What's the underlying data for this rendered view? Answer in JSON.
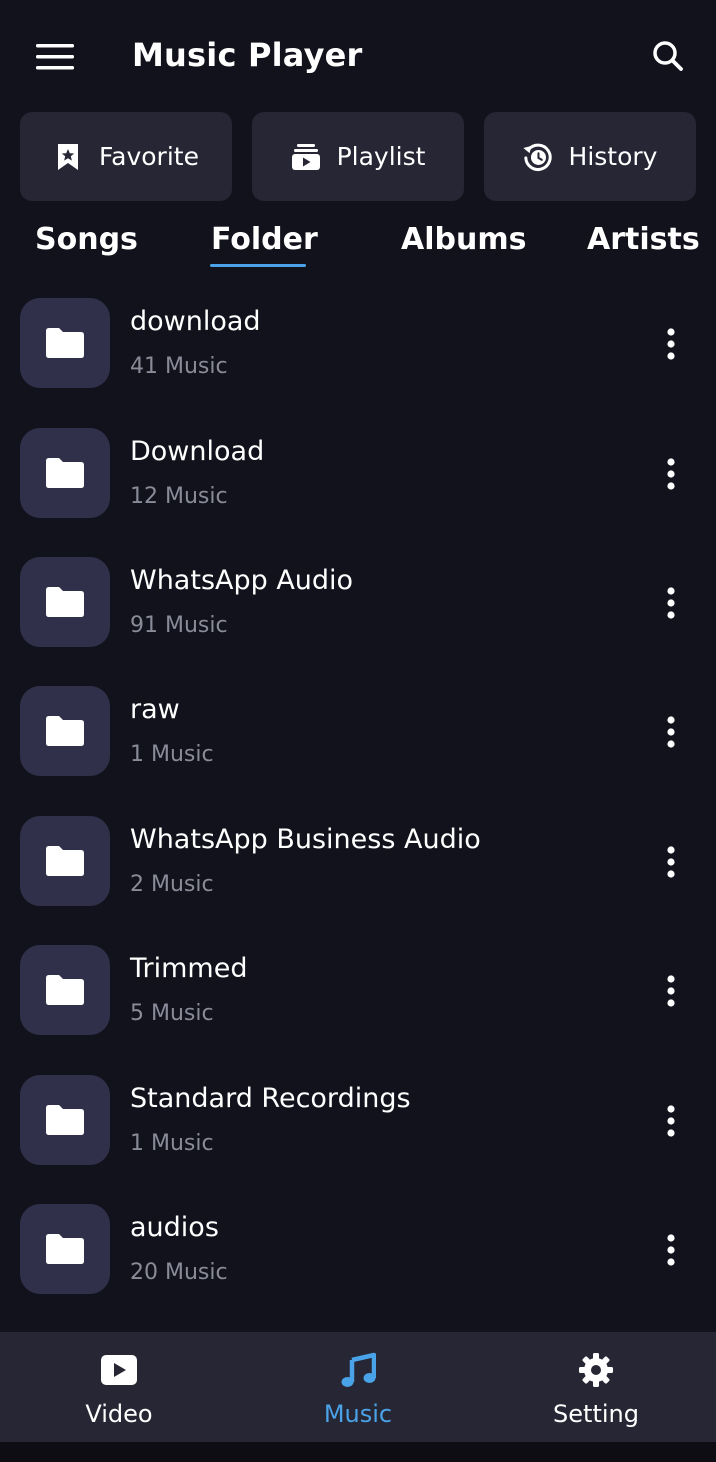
{
  "app": {
    "title": "Music Player"
  },
  "quick_actions": [
    {
      "label": "Favorite",
      "icon": "bookmark-star-icon"
    },
    {
      "label": "Playlist",
      "icon": "playlist-icon"
    },
    {
      "label": "History",
      "icon": "history-icon"
    }
  ],
  "tabs": [
    {
      "label": "Songs",
      "active": false
    },
    {
      "label": "Folder",
      "active": true
    },
    {
      "label": "Albums",
      "active": false
    },
    {
      "label": "Artists",
      "active": false
    }
  ],
  "folders": [
    {
      "name": "download",
      "count": "41 Music"
    },
    {
      "name": "Download",
      "count": "12 Music"
    },
    {
      "name": "WhatsApp Audio",
      "count": "91 Music"
    },
    {
      "name": "raw",
      "count": "1 Music"
    },
    {
      "name": "WhatsApp Business Audio",
      "count": "2 Music"
    },
    {
      "name": "Trimmed",
      "count": "5 Music"
    },
    {
      "name": "Standard Recordings",
      "count": "1 Music"
    },
    {
      "name": "audios",
      "count": "20 Music"
    }
  ],
  "bottom_nav": [
    {
      "label": "Video",
      "icon": "video-play-icon",
      "active": false
    },
    {
      "label": "Music",
      "icon": "music-note-icon",
      "active": true
    },
    {
      "label": "Setting",
      "icon": "gear-icon",
      "active": false
    }
  ],
  "colors": {
    "background": "#11121b",
    "surface": "#262634",
    "folder_thumb": "#30304a",
    "accent": "#4aa3e8",
    "secondary_text": "#8a8b99"
  }
}
